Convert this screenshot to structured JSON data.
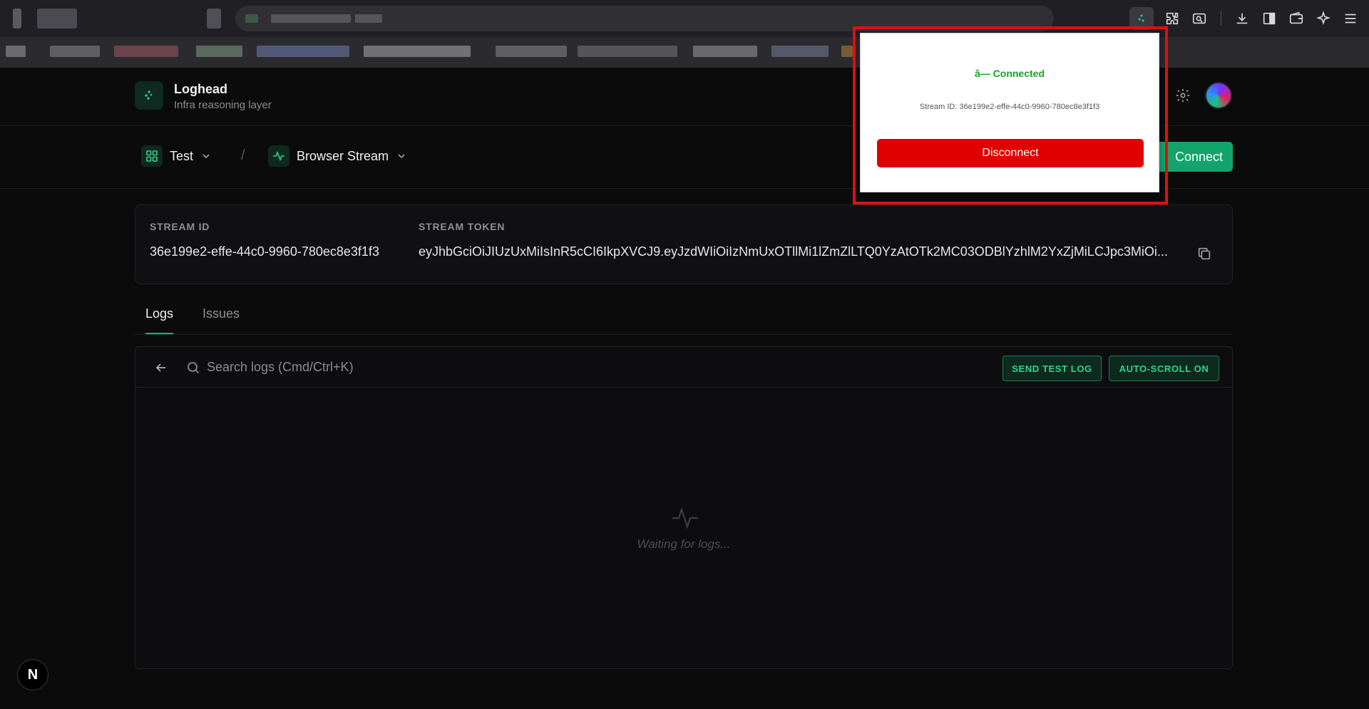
{
  "app": {
    "brand_name": "Loghead",
    "brand_subtitle": "Infra reasoning layer"
  },
  "breadcrumb": {
    "project": "Test",
    "separator": "/",
    "stream": "Browser Stream"
  },
  "actions": {
    "connect_label": "Connect"
  },
  "stream_card": {
    "id_label": "STREAM ID",
    "id_value": "36e199e2-effe-44c0-9960-780ec8e3f1f3",
    "token_label": "STREAM TOKEN",
    "token_value": "eyJhbGciOiJIUzUxMiIsInR5cCI6IkpXVCJ9.eyJzdWIiOiIzNmUxOTllMi1lZmZlLTQ0YzAtOTk2MC03ODBlYzhlM2YxZjMiLCJpc3MiOi..."
  },
  "tabs": [
    {
      "label": "Logs",
      "active": true
    },
    {
      "label": "Issues",
      "active": false
    }
  ],
  "logs": {
    "search_placeholder": "Search logs (Cmd/Ctrl+K)",
    "send_test_label": "SEND TEST LOG",
    "autoscroll_label": "AUTO-SCROLL ON",
    "empty_text": "Waiting for logs..."
  },
  "popup": {
    "status": "â— Connected",
    "stream_id": "Stream ID: 36e199e2-effe-44c0-9960-780ec8e3f1f3",
    "disconnect_label": "Disconnect"
  },
  "dev_badge": "N",
  "colors": {
    "accent": "#12a46b",
    "danger": "#e00000",
    "connected": "#15a329"
  }
}
